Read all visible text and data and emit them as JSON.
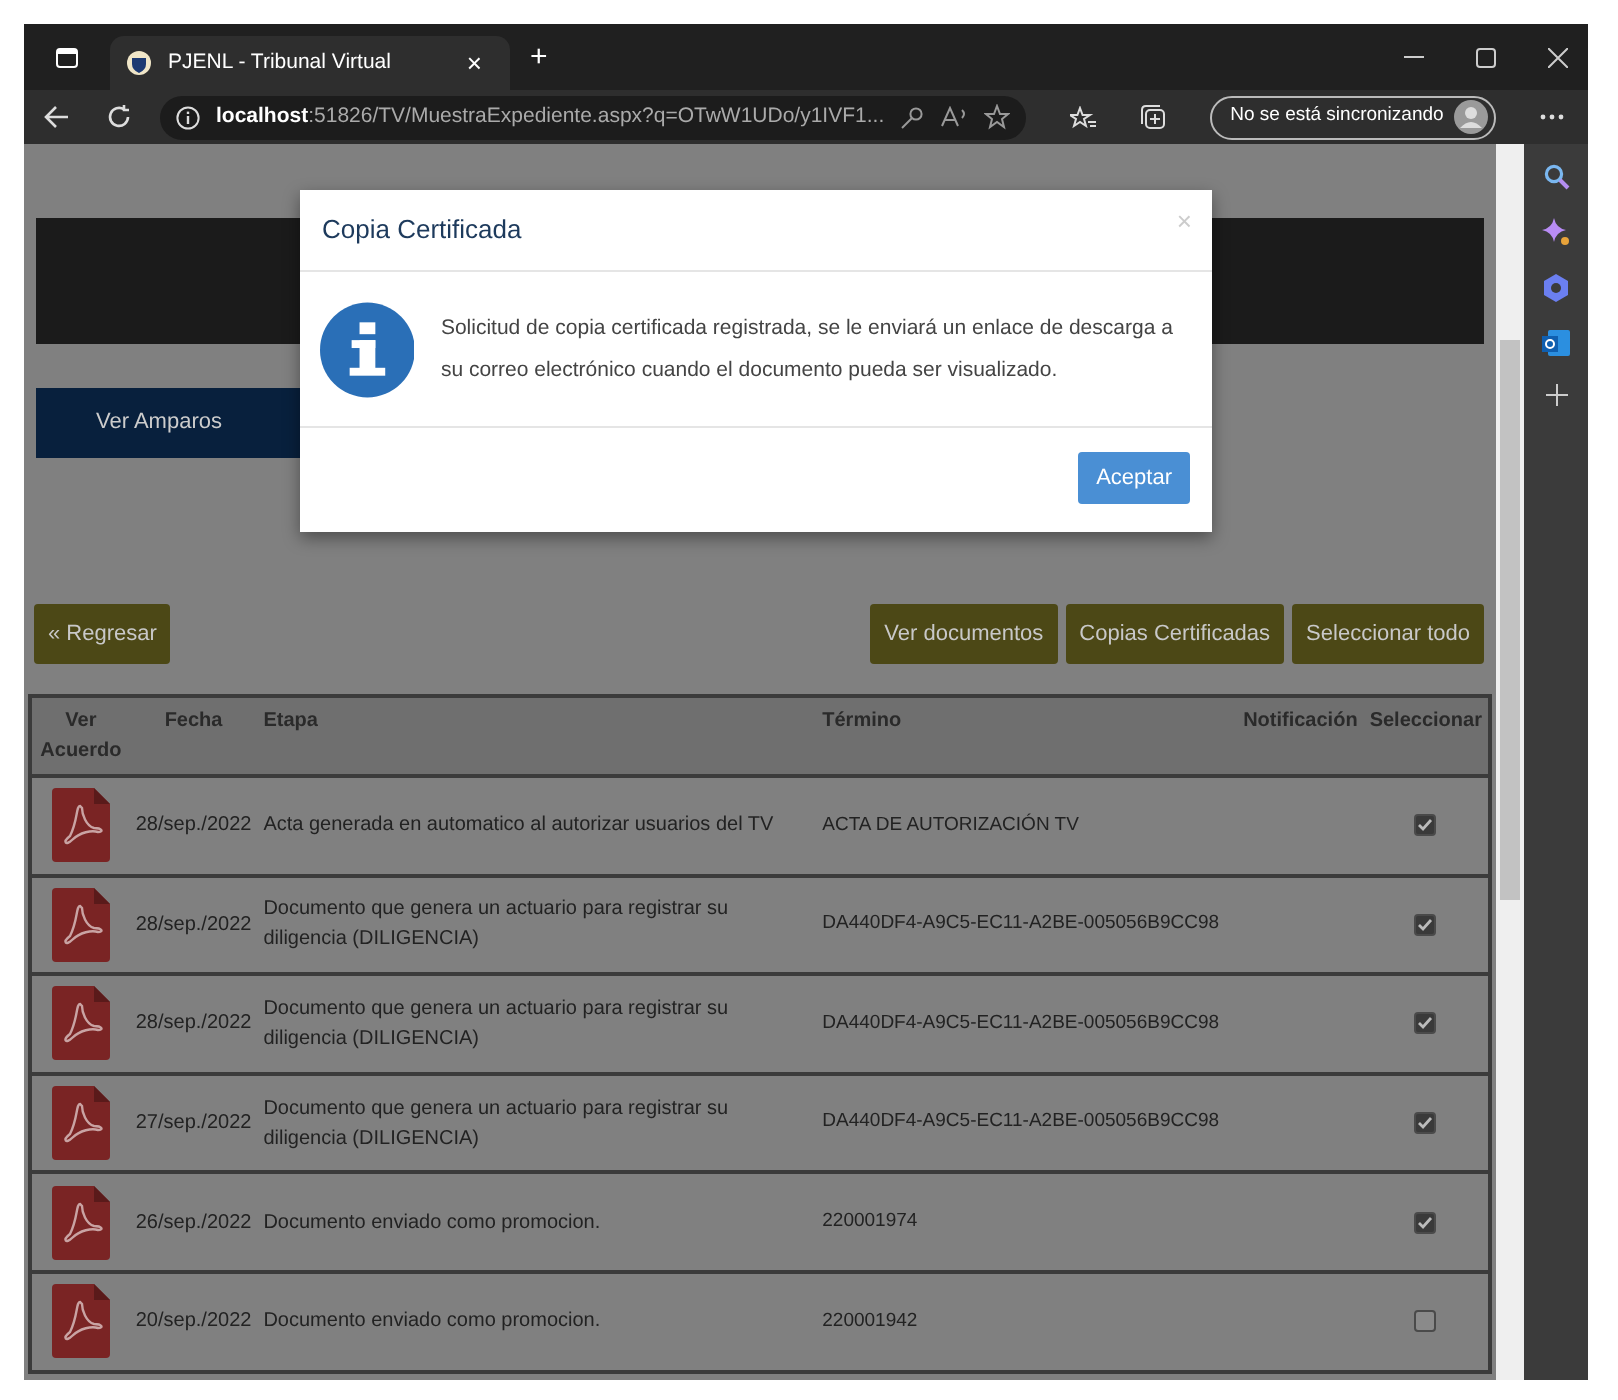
{
  "browser": {
    "tab_title": "PJENL - Tribunal Virtual",
    "tab_close": "×",
    "new_tab": "+",
    "address_host": "localhost",
    "address_path": ":51826/TV/MuestraExpediente.aspx?q=OTwW1UDo/y1IVF1...",
    "sync_button": "No se está sincronizando"
  },
  "page": {
    "amparos_button": "Ver Amparos",
    "back_button": "« Regresar",
    "action_buttons": [
      "Ver documentos",
      "Copias Certificadas",
      "Seleccionar todo"
    ],
    "table": {
      "columns": [
        "Ver Acuerdo",
        "Fecha",
        "Etapa",
        "Término",
        "Notificación",
        "Seleccionar"
      ],
      "rows": [
        {
          "fecha": "28/sep./2022",
          "etapa": "Acta generada en automatico al autorizar usuarios del TV",
          "termino": "ACTA DE AUTORIZACIÓN TV",
          "checked": true
        },
        {
          "fecha": "28/sep./2022",
          "etapa": "Documento que genera un actuario para registrar su diligencia (DILIGENCIA)",
          "termino": "DA440DF4-A9C5-EC11-A2BE-005056B9CC98",
          "checked": true
        },
        {
          "fecha": "28/sep./2022",
          "etapa": "Documento que genera un actuario para registrar su diligencia (DILIGENCIA)",
          "termino": "DA440DF4-A9C5-EC11-A2BE-005056B9CC98",
          "checked": true
        },
        {
          "fecha": "27/sep./2022",
          "etapa": "Documento que genera un actuario para registrar su diligencia (DILIGENCIA)",
          "termino": "DA440DF4-A9C5-EC11-A2BE-005056B9CC98",
          "checked": true
        },
        {
          "fecha": "26/sep./2022",
          "etapa": "Documento enviado como promocion.",
          "termino": "220001974",
          "checked": true
        },
        {
          "fecha": "20/sep./2022",
          "etapa": "Documento enviado como promocion.",
          "termino": "220001942",
          "checked": false
        }
      ]
    }
  },
  "modal": {
    "title": "Copia Certificada",
    "close": "×",
    "message": "Solicitud de copia certificada registrada, se le enviará un enlace de descarga a su correo electrónico cuando el documento pueda ser visualizado.",
    "button": "Aceptar"
  }
}
